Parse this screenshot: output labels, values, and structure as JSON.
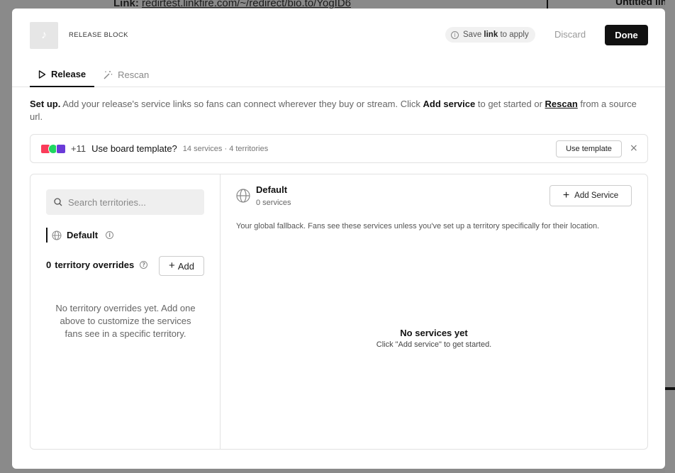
{
  "backdrop": {
    "link_label": "Link:",
    "link_url": "redirtest.linkfire.com/~/redirect/bio.to/YogID6",
    "right_text": "Untitled link"
  },
  "header": {
    "block_label": "RELEASE BLOCK",
    "save_hint_prefix": "Save",
    "save_hint_bold": "link",
    "save_hint_suffix": "to apply",
    "discard_label": "Discard",
    "done_label": "Done"
  },
  "tabs": [
    {
      "label": "Release",
      "icon": "play-icon",
      "active": true
    },
    {
      "label": "Rescan",
      "icon": "magic-wand-icon",
      "active": false
    }
  ],
  "intro": {
    "lead": "Set up.",
    "text1": "Add your release's service links so fans can connect wherever they buy or stream. Click",
    "add_service": "Add service",
    "text2": "to get started or",
    "rescan": "Rescan",
    "text3": "from a source url."
  },
  "template": {
    "extra_count": "+11",
    "question": "Use board template?",
    "meta": "14 services · 4 territories",
    "button": "Use template",
    "close": "×",
    "colors": {
      "apple": "#fa3c5a",
      "spotify": "#1ed760",
      "amazon": "#6a3bd8"
    }
  },
  "territories": {
    "search_placeholder": "Search territories...",
    "default_label": "Default",
    "override_count": "0",
    "override_label": "territory overrides",
    "add_label": "Add",
    "empty_text": "No territory overrides yet. Add one above to customize the services fans see in a specific territory."
  },
  "detail": {
    "title": "Default",
    "count": "0 services",
    "add_service_label": "Add Service",
    "description": "Your global fallback. Fans see these services unless you've set up a territory specifically for their location.",
    "empty_title": "No services yet",
    "empty_sub": "Click \"Add service\" to get started."
  }
}
